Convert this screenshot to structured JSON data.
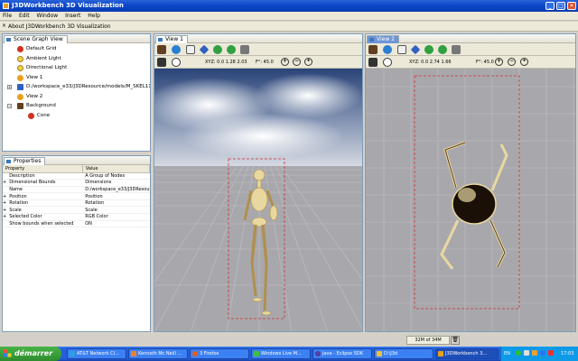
{
  "window": {
    "title": "J3DWorkbench 3D Visualization",
    "min": "_",
    "max": "□",
    "close": "✕"
  },
  "menu": [
    "File",
    "Edit",
    "Window",
    "Insert",
    "Help"
  ],
  "info": {
    "close": "×",
    "text": "About J3DWorkbench 3D Visualization"
  },
  "scene_graph": {
    "tab": "Scene Graph View",
    "items": [
      {
        "label": "Default Grid",
        "icon_color": "#d03020"
      },
      {
        "label": "Ambient Light",
        "icon_color": "#f0d040"
      },
      {
        "label": "Directional Light",
        "icon_color": "#f0d040"
      },
      {
        "label": "View 1",
        "icon_color": "#e8a020"
      },
      {
        "label": "D:/workspace_e33/J3DResource/models/M_SKEL11.3DS",
        "icon_color": "#3060c0"
      },
      {
        "label": "View 2",
        "icon_color": "#e8a020"
      },
      {
        "label": "Background",
        "icon_color": "#604020"
      },
      {
        "label": "Cone",
        "icon_color": "#d03020"
      }
    ]
  },
  "properties": {
    "tab": "Properties",
    "headers": [
      "Property",
      "Value"
    ],
    "rows": [
      {
        "name": "Description",
        "value": "A Group of Nodes",
        "exp": ""
      },
      {
        "name": "Dimensional Bounds",
        "value": "Dimensions",
        "exp": "+"
      },
      {
        "name": "Name",
        "value": "D:/workspace_e33/J3DResou",
        "exp": ""
      },
      {
        "name": "Position",
        "value": "Position",
        "exp": "+"
      },
      {
        "name": "Rotation",
        "value": "Rotation",
        "exp": "+"
      },
      {
        "name": "Scale",
        "value": "Scale",
        "exp": "+"
      },
      {
        "name": "Selected Color",
        "value": "RGB Color",
        "exp": "+"
      },
      {
        "name": "Show bounds when selected",
        "value": "ON",
        "exp": ""
      }
    ]
  },
  "view1": {
    "tab": "View 1",
    "xyz": "XYZ: 0.0 1.28 2.03",
    "fov": "F°: 45.0"
  },
  "view2": {
    "tab": "View 2",
    "xyz": "XYZ: 0.0 2.74 1.66",
    "fov": "F°: 45.0"
  },
  "status": {
    "memory": "32M of 34M"
  },
  "taskbar": {
    "start": "démarrer",
    "tasks": [
      "AT&T Network Cl...",
      "Kenneth Mc Neill ...",
      "3 Firefox",
      "Windows Live M...",
      "Java - Eclipse SDK",
      "D:\\J3d",
      "J3DWorkbench 3..."
    ],
    "lang": "EN",
    "clock": "17:03"
  },
  "colors": {
    "accent": "#0a46c8",
    "panel_border": "#7f9db9",
    "selection": "#6f95d8",
    "bounds": "#d03030"
  }
}
